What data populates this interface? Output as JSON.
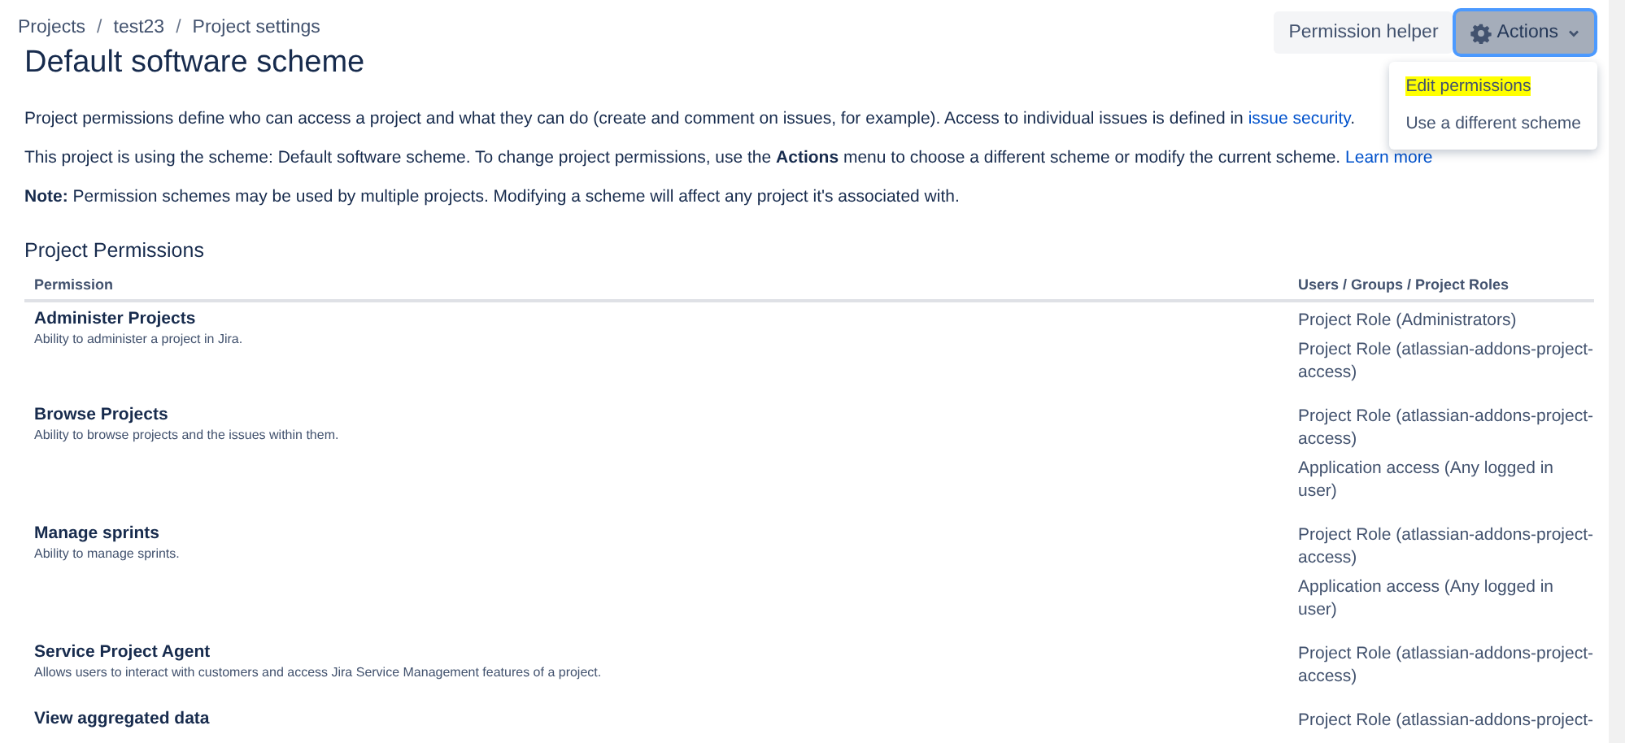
{
  "breadcrumbs": [
    {
      "kind": "link",
      "text": "Projects"
    },
    {
      "kind": "separator",
      "text": "/"
    },
    {
      "kind": "link",
      "text": "test23"
    },
    {
      "kind": "separator",
      "text": "/"
    },
    {
      "kind": "link",
      "text": "Project settings"
    }
  ],
  "title": "Default software scheme",
  "buttons": [
    {
      "label": "Permission helper",
      "kind": "plain",
      "focused": false
    },
    {
      "label": "Actions",
      "kind": "menu",
      "focused": true
    }
  ],
  "menu": {
    "open": true,
    "items": [
      {
        "label": "Edit permissions",
        "highlighted": true
      },
      {
        "label": "Use a different scheme",
        "highlighted": false
      }
    ]
  },
  "paragraphs": [
    [
      {
        "kind": "text",
        "text": "Project permissions define who can access a project and what they can do (create and comment on issues, for example). Access to individual issues is defined in "
      },
      {
        "kind": "link",
        "text": "issue security"
      },
      {
        "kind": "text",
        "text": "."
      }
    ],
    [
      {
        "kind": "text",
        "text": "This project is using the scheme: Default software scheme. To change project permissions, use the **Actions** menu to choose a different scheme or modify the current scheme. "
      },
      {
        "kind": "link",
        "text": "Learn more"
      }
    ],
    [
      {
        "kind": "text",
        "text": "**Note:** Permission schemes may be used by multiple projects. Modifying a scheme will affect any project it's associated with."
      }
    ]
  ],
  "section_title": "Project Permissions",
  "table": {
    "columns": [
      "Permission",
      "Users / Groups / Project Roles"
    ],
    "rows": [
      {
        "name": "Administer Projects",
        "description": "Ability to administer a project in Jira.",
        "grants": [
          "Project Role (Administrators)",
          "Project Role (atlassian-addons-project-access)"
        ]
      },
      {
        "name": "Browse Projects",
        "description": "Ability to browse projects and the issues within them.",
        "grants": [
          "Project Role (atlassian-addons-project-access)",
          "Application access (Any logged in user)"
        ]
      },
      {
        "name": "Manage sprints",
        "description": "Ability to manage sprints.",
        "grants": [
          "Project Role (atlassian-addons-project-access)",
          "Application access (Any logged in user)"
        ]
      },
      {
        "name": "Service Project Agent",
        "description": "Allows users to interact with customers and access Jira Service Management features of a project.",
        "grants": [
          "Project Role (atlassian-addons-project-access)"
        ]
      },
      {
        "name": "View aggregated data",
        "grants": [
          "Project Role (atlassian-addons-project-"
        ]
      }
    ]
  }
}
